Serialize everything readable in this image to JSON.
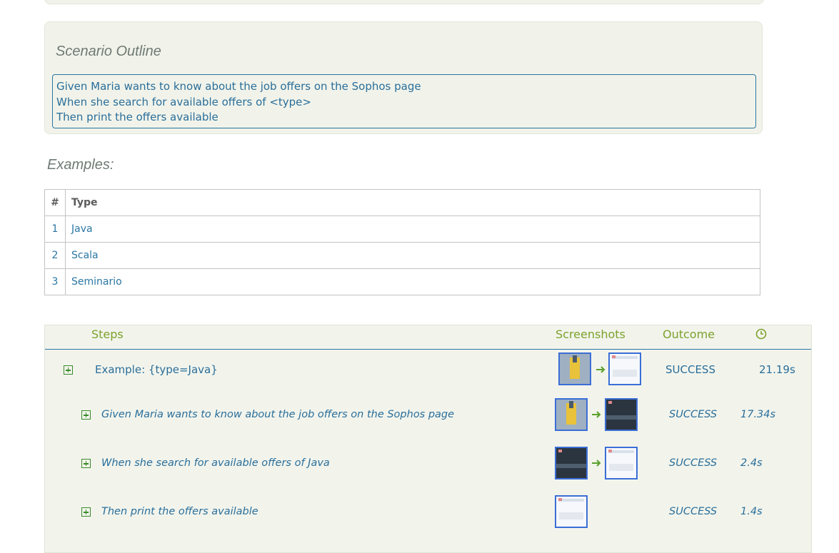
{
  "scenario": {
    "title": "Scenario Outline",
    "lines": [
      "Given Maria wants to know about the job offers on the Sophos page",
      "When she search for available offers of <type>",
      "Then print the offers available"
    ]
  },
  "examples": {
    "title": "Examples:",
    "columns": [
      "#",
      "Type"
    ],
    "rows": [
      [
        "1",
        "Java"
      ],
      [
        "2",
        "Scala"
      ],
      [
        "3",
        "Seminario"
      ]
    ]
  },
  "steps_table": {
    "headers": {
      "steps": "Steps",
      "screenshots": "Screenshots",
      "outcome": "Outcome",
      "duration_icon": "clock-icon"
    },
    "example_row": {
      "label": "Example: {type=Java}",
      "outcome": "SUCCESS",
      "duration": "21.19s"
    },
    "step_rows": [
      {
        "label": "Given Maria wants to know about the job offers on the Sophos page",
        "outcome": "SUCCESS",
        "duration": "17.34s"
      },
      {
        "label": "When she search for available offers of Java",
        "outcome": "SUCCESS",
        "duration": "2.4s"
      },
      {
        "label": "Then print the offers available",
        "outcome": "SUCCESS",
        "duration": "1.4s"
      }
    ]
  },
  "colors": {
    "accent_green": "#7da12c",
    "link_blue": "#2a6e9a",
    "panel_bg": "#f1f3ea",
    "expand_green": "#3a8a2a"
  }
}
